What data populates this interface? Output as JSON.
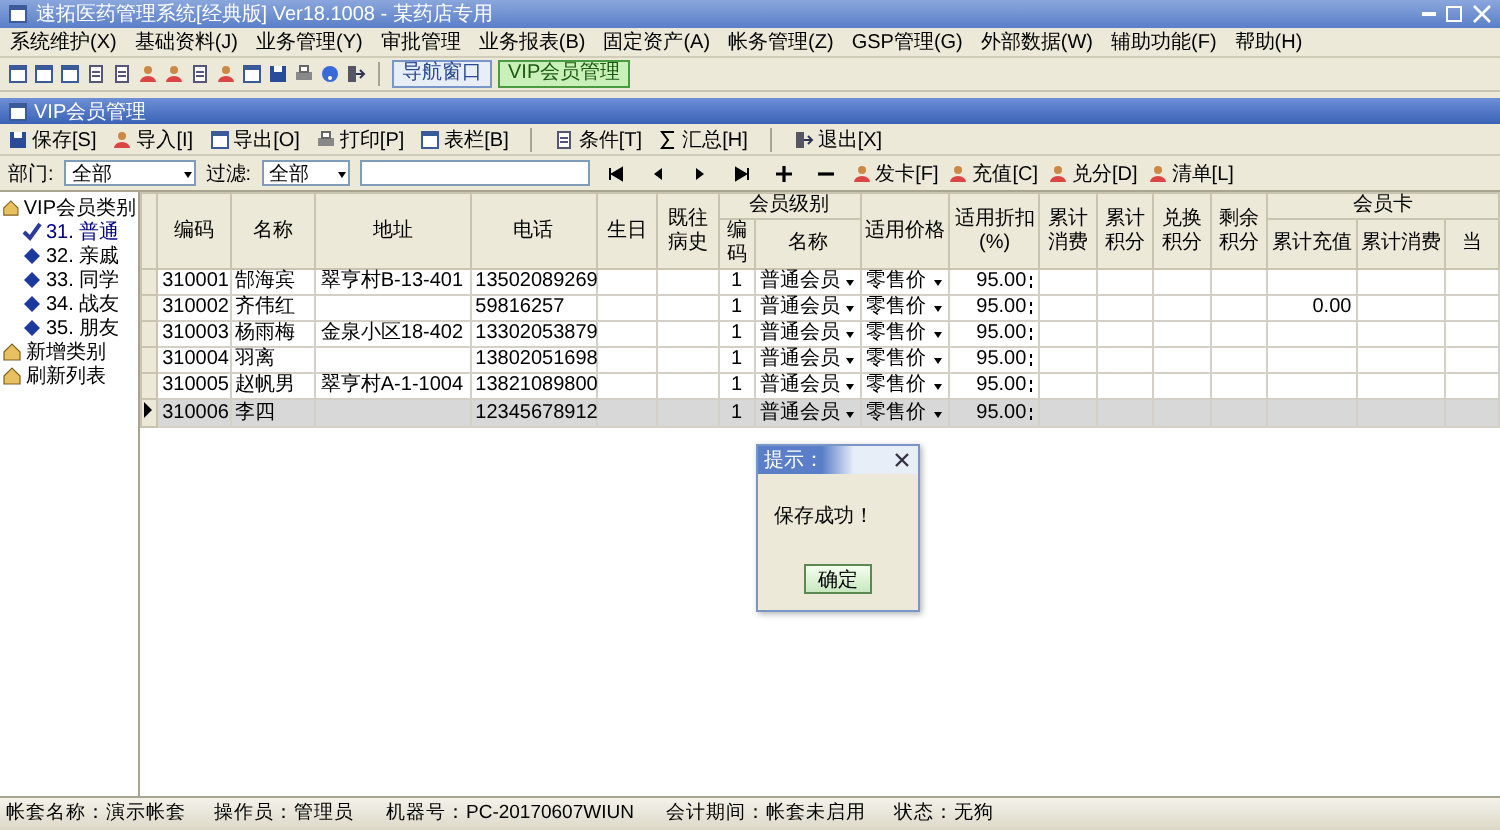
{
  "window": {
    "title": "速拓医药管理系统[经典版] Ver18.1008 - 某药店专用"
  },
  "menu": [
    "系统维护(X)",
    "基础资料(J)",
    "业务管理(Y)",
    "审批管理",
    "业务报表(B)",
    "固定资产(A)",
    "帐务管理(Z)",
    "GSP管理(G)",
    "外部数据(W)",
    "辅助功能(F)",
    "帮助(H)"
  ],
  "window_tabs": [
    {
      "label": "导航窗口",
      "selected": false
    },
    {
      "label": "VIP会员管理",
      "selected": true
    }
  ],
  "child_window": {
    "title": "VIP会员管理"
  },
  "actions": [
    [
      "保存[S]",
      "导入[I]",
      "导出[O]",
      "打印[P]",
      "表栏[B]"
    ],
    [
      "条件[T]",
      "汇总[H]"
    ],
    [
      "退出[X]"
    ]
  ],
  "filter": {
    "department_label": "部门:",
    "department": "全部",
    "filter_label": "过滤:",
    "filter": "全部"
  },
  "card_actions": [
    "发卡[F]",
    "充值[C]",
    "兑分[D]",
    "清单[L]"
  ],
  "tree": [
    {
      "label": "VIP会员类别",
      "selected": false,
      "children": [
        {
          "label": "31. 普通",
          "selected": true
        },
        {
          "label": "32. 亲戚",
          "selected": false
        },
        {
          "label": "33. 同学",
          "selected": false
        },
        {
          "label": "34. 战友",
          "selected": false
        },
        {
          "label": "35. 朋友",
          "selected": false
        }
      ]
    },
    {
      "label": "新增类别",
      "selected": false
    },
    {
      "label": "刷新列表",
      "selected": false
    }
  ],
  "table": {
    "columns": [
      {
        "label": "编码"
      },
      {
        "label": "名称"
      },
      {
        "label": "地址"
      },
      {
        "label": "电话"
      },
      {
        "label": "生日"
      },
      {
        "label": "既往病史"
      },
      {
        "label": "会员级别",
        "children": [
          "编码",
          "名称"
        ]
      },
      {
        "label": "适用价格"
      },
      {
        "label": "适用折扣(%)"
      },
      {
        "label": "累计消费"
      },
      {
        "label": "累计积分"
      },
      {
        "label": "兑换积分"
      },
      {
        "label": "剩余积分"
      },
      {
        "label": "会员卡",
        "children": [
          "累计充值",
          "累计消费",
          "当"
        ]
      }
    ],
    "rows": [
      {
        "code": "310001",
        "name": "郜海宾",
        "address": "翠亨村B-13-401",
        "phone": "13502089269",
        "level_code": "1",
        "level_name": "普通会员",
        "price": "零售价",
        "discount": "95.00",
        "selected": false
      },
      {
        "code": "310002",
        "name": "齐伟红",
        "phone": "59816257",
        "level_code": "1",
        "level_name": "普通会员",
        "price": "零售价",
        "discount": "95.00",
        "recharge": "0.00",
        "selected": false
      },
      {
        "code": "310003",
        "name": "杨雨梅",
        "address": "金泉小区18-402",
        "phone": "13302053879",
        "level_code": "1",
        "level_name": "普通会员",
        "price": "零售价",
        "discount": "95.00",
        "selected": false
      },
      {
        "code": "310004",
        "name": "羽离",
        "phone": "13802051698",
        "level_code": "1",
        "level_name": "普通会员",
        "price": "零售价",
        "discount": "95.00",
        "selected": false
      },
      {
        "code": "310005",
        "name": "赵帆男",
        "address": "翠亨村A-1-1004",
        "phone": "13821089800",
        "level_code": "1",
        "level_name": "普通会员",
        "price": "零售价",
        "discount": "95.00",
        "selected": false
      },
      {
        "code": "310006",
        "name": "李四",
        "phone": "12345678912",
        "level_code": "1",
        "level_name": "普通会员",
        "price": "零售价",
        "discount": "95.00",
        "selected": true
      }
    ]
  },
  "dialog": {
    "title": "提示：",
    "message": "保存成功！",
    "button": "确定"
  },
  "status_bar": [
    "帐套名称：演示帐套",
    "操作员：管理员",
    "机器号：PC-20170607WIUN",
    "会计期间：帐套未启用",
    "状态：无狗"
  ]
}
